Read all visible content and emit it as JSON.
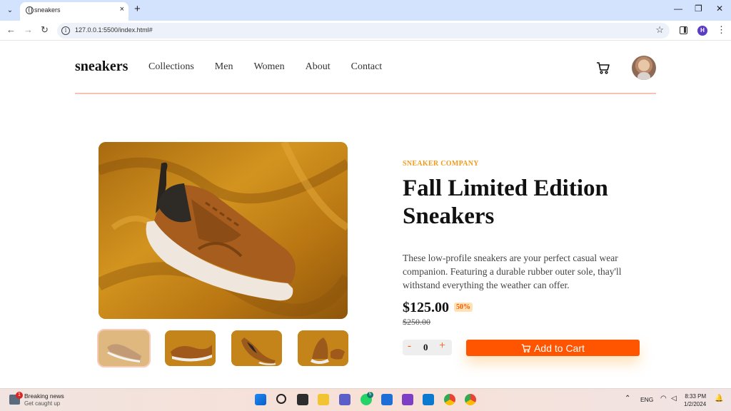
{
  "browser": {
    "tab_title": "sneakers",
    "tab_close": "×",
    "new_tab": "+",
    "url": "127.0.0.1:5500/index.html#",
    "profile_initial": "H",
    "window_minimize": "—",
    "window_restore": "❐",
    "window_close": "✕"
  },
  "site": {
    "logo": "sneakers",
    "nav": [
      "Collections",
      "Men",
      "Women",
      "About",
      "Contact"
    ]
  },
  "product": {
    "company": "SNEAKER COMPANY",
    "title": "Fall Limited Edition Sneakers",
    "description": "These low-profile sneakers are your perfect casual wear companion. Featuring a durable rubber outer sole, thay'll withstand everything the weather can offer.",
    "price": "$125.00",
    "discount": "50%",
    "old_price": "$250.00",
    "quantity": "0",
    "minus": "-",
    "plus": "+",
    "add_to_cart": "Add to Cart"
  },
  "taskbar": {
    "news_badge": "1",
    "news_title": "Breaking news",
    "news_subtitle": "Get caught up",
    "language": "ENG",
    "time": "8:33 PM",
    "date": "1/2/2024",
    "badge_whatsapp": "5"
  },
  "colors": {
    "accent": "#ff5500",
    "company_text": "#f29b1b",
    "divider": "#f6c2b4",
    "tab_strip": "#d3e3fd"
  }
}
